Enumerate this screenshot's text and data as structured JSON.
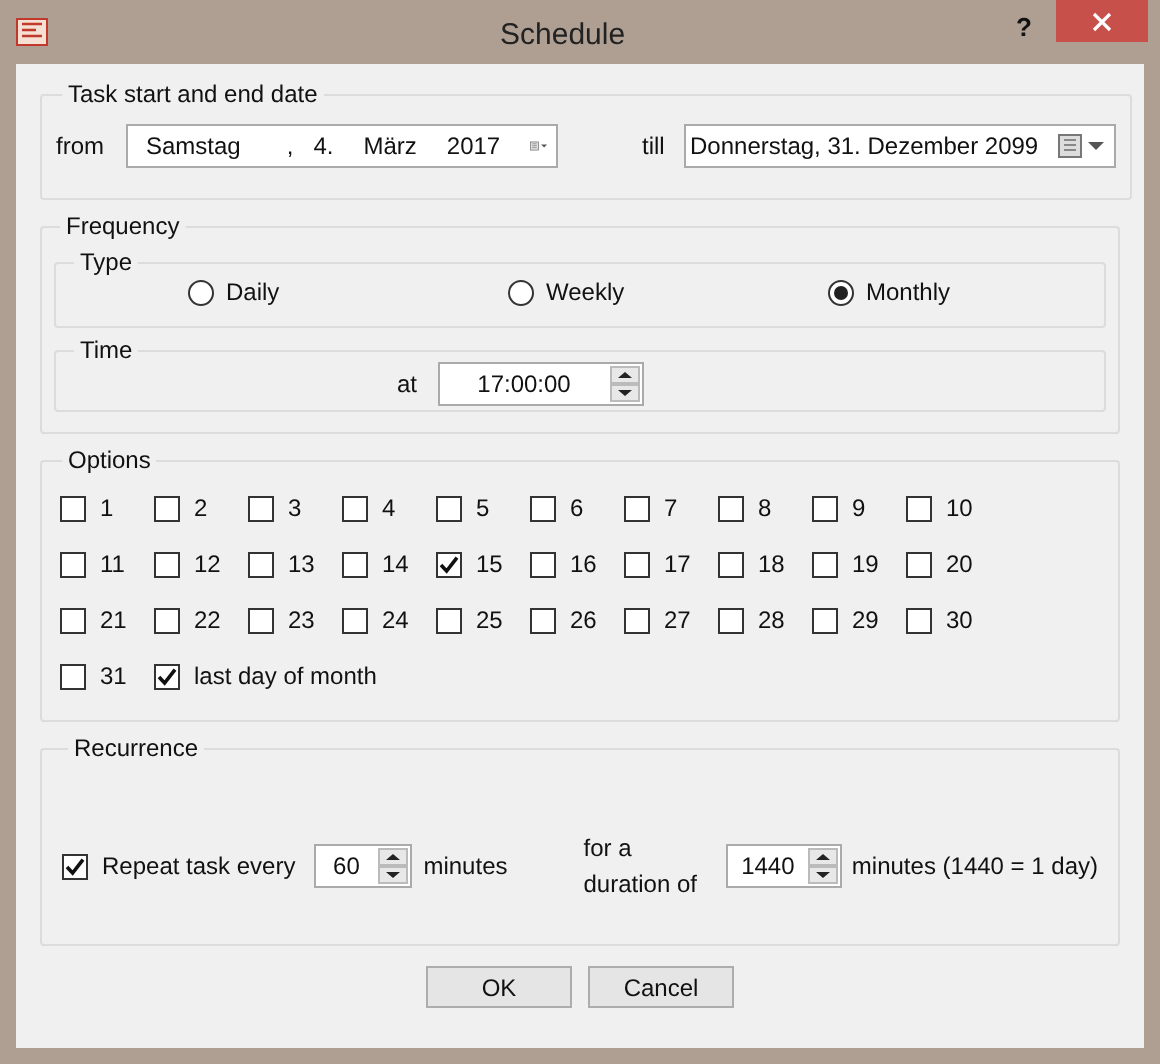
{
  "window": {
    "title": "Schedule",
    "help": "?"
  },
  "dates": {
    "legend": "Task start and end date",
    "from_label": "from",
    "from_parts": [
      "Samstag",
      ",",
      "4.",
      "März",
      "2017"
    ],
    "till_label": "till",
    "till_value": "Donnerstag, 31. Dezember 2099"
  },
  "frequency": {
    "legend": "Frequency",
    "type_legend": "Type",
    "types": [
      {
        "label": "Daily",
        "selected": false
      },
      {
        "label": "Weekly",
        "selected": false
      },
      {
        "label": "Monthly",
        "selected": true
      }
    ],
    "time_legend": "Time",
    "at_label": "at",
    "time_value": "17:00:00"
  },
  "options": {
    "legend": "Options",
    "days": [
      {
        "label": "1",
        "checked": false
      },
      {
        "label": "2",
        "checked": false
      },
      {
        "label": "3",
        "checked": false
      },
      {
        "label": "4",
        "checked": false
      },
      {
        "label": "5",
        "checked": false
      },
      {
        "label": "6",
        "checked": false
      },
      {
        "label": "7",
        "checked": false
      },
      {
        "label": "8",
        "checked": false
      },
      {
        "label": "9",
        "checked": false
      },
      {
        "label": "10",
        "checked": false
      },
      {
        "label": "11",
        "checked": false
      },
      {
        "label": "12",
        "checked": false
      },
      {
        "label": "13",
        "checked": false
      },
      {
        "label": "14",
        "checked": false
      },
      {
        "label": "15",
        "checked": true
      },
      {
        "label": "16",
        "checked": false
      },
      {
        "label": "17",
        "checked": false
      },
      {
        "label": "18",
        "checked": false
      },
      {
        "label": "19",
        "checked": false
      },
      {
        "label": "20",
        "checked": false
      },
      {
        "label": "21",
        "checked": false
      },
      {
        "label": "22",
        "checked": false
      },
      {
        "label": "23",
        "checked": false
      },
      {
        "label": "24",
        "checked": false
      },
      {
        "label": "25",
        "checked": false
      },
      {
        "label": "26",
        "checked": false
      },
      {
        "label": "27",
        "checked": false
      },
      {
        "label": "28",
        "checked": false
      },
      {
        "label": "29",
        "checked": false
      },
      {
        "label": "30",
        "checked": false
      },
      {
        "label": "31",
        "checked": false
      },
      {
        "label": "last day of month",
        "checked": true
      }
    ]
  },
  "recurrence": {
    "legend": "Recurrence",
    "repeat_checked": true,
    "repeat_label": "Repeat task every",
    "interval": "60",
    "interval_unit": "minutes",
    "duration_label": "for a duration of",
    "duration": "1440",
    "duration_unit": "minutes (1440 = 1 day)"
  },
  "buttons": [
    "OK",
    "Cancel"
  ]
}
